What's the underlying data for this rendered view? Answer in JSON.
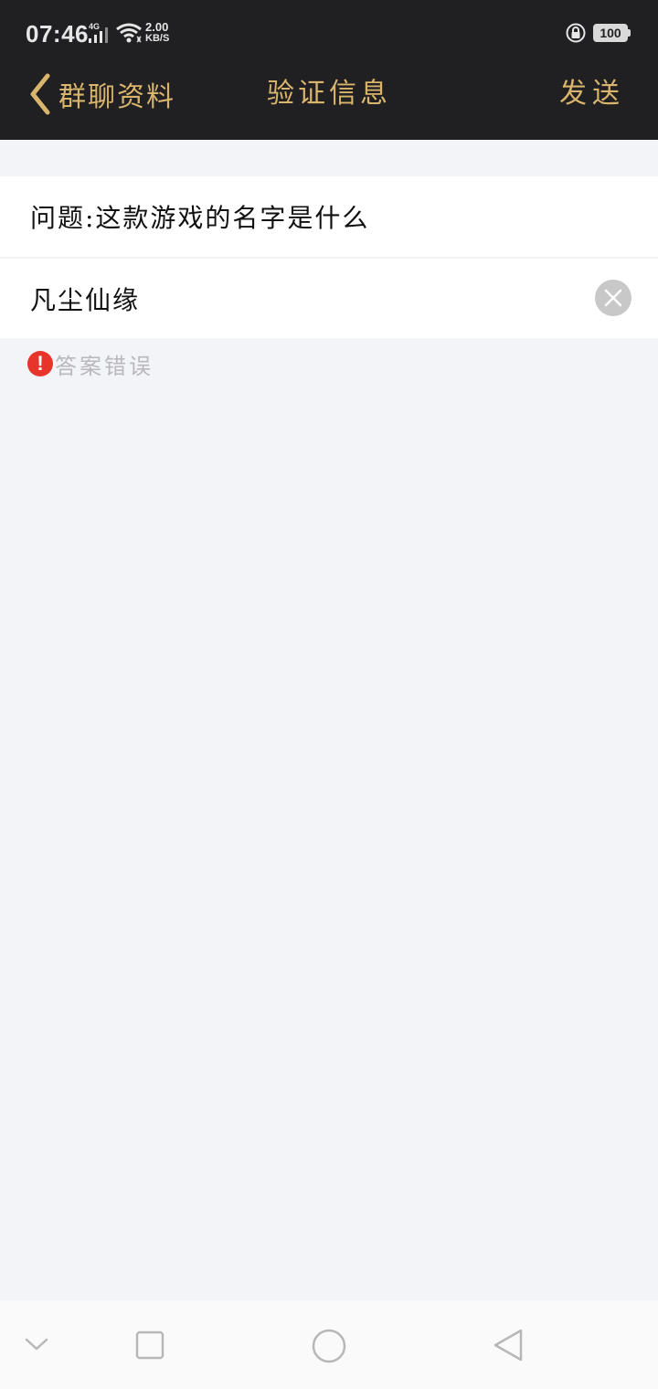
{
  "status_bar": {
    "time": "07:46",
    "network_type": "4G",
    "speed_value": "2.00",
    "speed_unit": "KB/S",
    "battery": "100",
    "icons": [
      "signal-icon",
      "wifi-icon",
      "rotate-lock-icon",
      "battery-icon"
    ]
  },
  "nav": {
    "back_label": "群聊资料",
    "title": "验证信息",
    "action_label": "发送"
  },
  "question": {
    "text": "问题:这款游戏的名字是什么"
  },
  "answer": {
    "value": "凡尘仙缘",
    "placeholder": ""
  },
  "error": {
    "icon": "!",
    "message": "答案错误"
  },
  "system_nav": {
    "buttons": [
      "collapse-button",
      "recents-button",
      "home-button",
      "back-button"
    ]
  },
  "colors": {
    "header_bg": "#201f21",
    "accent_gold": "#d9b46d",
    "page_bg": "#f3f4f8",
    "error_red": "#e8352c",
    "error_text": "#b9b9bd"
  }
}
